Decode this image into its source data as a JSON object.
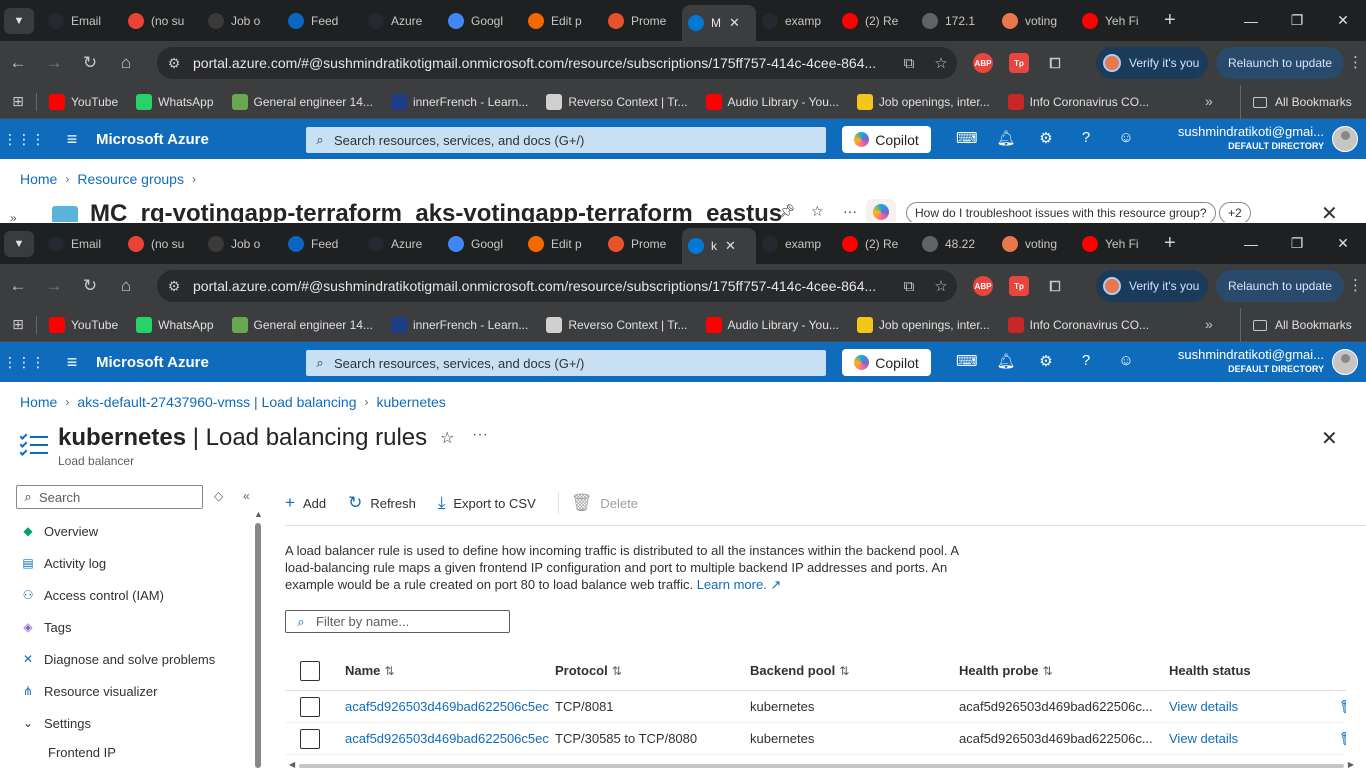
{
  "browser": {
    "back_tabs": [
      {
        "title": "Email",
        "icon": "github-icon",
        "color": "#24292f"
      },
      {
        "title": "(no su",
        "icon": "gmail-icon",
        "color": "#ea4335"
      },
      {
        "title": "Job o",
        "icon": "openai-icon",
        "color": "#3a3a3a"
      },
      {
        "title": "Feed",
        "icon": "linkedin-icon",
        "color": "#0a66c2"
      },
      {
        "title": "Azure",
        "icon": "github-icon",
        "color": "#24292f"
      },
      {
        "title": "Googl",
        "icon": "gemini-icon",
        "color": "#4285f4"
      },
      {
        "title": "Edit p",
        "icon": "grafana-icon",
        "color": "#f46800"
      },
      {
        "title": "Prome",
        "icon": "prometheus-icon",
        "color": "#e6522c"
      },
      {
        "title": "M",
        "icon": "azure-icon",
        "color": "#0078d4",
        "active": true
      },
      {
        "title": "examp",
        "icon": "github-icon",
        "color": "#24292f"
      },
      {
        "title": "(2) Re",
        "icon": "youtube-icon",
        "color": "#ff0000"
      },
      {
        "title": "172.1",
        "icon": "globe-icon",
        "color": "#5f6368"
      },
      {
        "title": "voting",
        "icon": "voting-icon",
        "color": "#e8774b"
      },
      {
        "title": "Yeh Fi",
        "icon": "youtube-icon",
        "color": "#ff0000"
      }
    ],
    "front_tabs": [
      {
        "title": "Email",
        "icon": "github-icon",
        "color": "#24292f"
      },
      {
        "title": "(no su",
        "icon": "gmail-icon",
        "color": "#ea4335"
      },
      {
        "title": "Job o",
        "icon": "openai-icon",
        "color": "#3a3a3a"
      },
      {
        "title": "Feed",
        "icon": "linkedin-icon",
        "color": "#0a66c2"
      },
      {
        "title": "Azure",
        "icon": "github-icon",
        "color": "#24292f"
      },
      {
        "title": "Googl",
        "icon": "gemini-icon",
        "color": "#4285f4"
      },
      {
        "title": "Edit p",
        "icon": "grafana-icon",
        "color": "#f46800"
      },
      {
        "title": "Prome",
        "icon": "prometheus-icon",
        "color": "#e6522c"
      },
      {
        "title": "k",
        "icon": "azure-icon",
        "color": "#0078d4",
        "active": true
      },
      {
        "title": "examp",
        "icon": "github-icon",
        "color": "#24292f"
      },
      {
        "title": "(2) Re",
        "icon": "youtube-icon",
        "color": "#ff0000"
      },
      {
        "title": "48.22",
        "icon": "globe-icon",
        "color": "#5f6368"
      },
      {
        "title": "voting",
        "icon": "voting-icon",
        "color": "#e8774b"
      },
      {
        "title": "Yeh Fi",
        "icon": "youtube-icon",
        "color": "#ff0000"
      }
    ],
    "url": "portal.azure.com/#@sushmindratikotigmail.onmicrosoft.com/resource/subscriptions/175ff757-414c-4cee-864...",
    "verify_label": "Verify it's you",
    "relaunch_label": "Relaunch to update",
    "bookmarks": [
      {
        "label": "YouTube",
        "color": "#ff0000"
      },
      {
        "label": "WhatsApp",
        "color": "#25d366"
      },
      {
        "label": "General engineer 14...",
        "color": "#6aa84f"
      },
      {
        "label": "innerFrench - Learn...",
        "color": "#1f3c88"
      },
      {
        "label": "Reverso Context | Tr...",
        "color": "#d0d0d0"
      },
      {
        "label": "Audio Library - You...",
        "color": "#ff0000"
      },
      {
        "label": "Job openings, inter...",
        "color": "#f5c518"
      },
      {
        "label": "Info Coronavirus CO...",
        "color": "#c62828"
      }
    ],
    "all_bookmarks": "All Bookmarks"
  },
  "azure": {
    "brand": "Microsoft Azure",
    "search_placeholder": "Search resources, services, and docs (G+/)",
    "copilot": "Copilot",
    "account_email": "sushmindratikoti@gmai...",
    "account_dir": "DEFAULT DIRECTORY",
    "accent": "#0f6cbd"
  },
  "back_page": {
    "crumbs": [
      "Home",
      "Resource groups"
    ],
    "title": "MC_rg-votingapp-terraform_aks-votingapp-terraform_eastus",
    "chip_question": "How do I troubleshoot issues with this resource group?",
    "chip_more": "+2"
  },
  "page": {
    "crumbs": [
      "Home",
      "aks-default-27437960-vmss | Load balancing",
      "kubernetes"
    ],
    "title_main": "kubernetes",
    "title_rest": " | Load balancing rules",
    "subtitle": "Load balancer",
    "side_search_placeholder": "Search",
    "menu": [
      {
        "label": "Overview",
        "icon": "overview-icon",
        "color": "#00a36c",
        "glyph": "◆"
      },
      {
        "label": "Activity log",
        "icon": "activity-log-icon",
        "color": "#0f6cbd",
        "glyph": "▤"
      },
      {
        "label": "Access control (IAM)",
        "icon": "iam-icon",
        "color": "#0f6cbd",
        "glyph": "⚇"
      },
      {
        "label": "Tags",
        "icon": "tag-icon",
        "color": "#8661c5",
        "glyph": "◈"
      },
      {
        "label": "Diagnose and solve problems",
        "icon": "diagnose-icon",
        "color": "#0f6cbd",
        "glyph": "✕"
      },
      {
        "label": "Resource visualizer",
        "icon": "visualizer-icon",
        "color": "#0f6cbd",
        "glyph": "⋔"
      },
      {
        "label": "Settings",
        "icon": "chevron-down-icon",
        "color": "#323130",
        "glyph": "⌄"
      }
    ],
    "submenu": {
      "label": "Frontend IP",
      "icon": "frontend-ip-icon"
    },
    "toolbar": {
      "add": "Add",
      "refresh": "Refresh",
      "export": "Export to CSV",
      "delete": "Delete"
    },
    "description": "A load balancer rule is used to define how incoming traffic is distributed to all the instances within the backend pool. A load-balancing rule maps a given frontend IP configuration and port to multiple backend IP addresses and ports. An example would be a rule created on port 80 to load balance web traffic.",
    "learn_more": "Learn more.",
    "filter_placeholder": "Filter by name...",
    "columns": [
      "Name",
      "Protocol",
      "Backend pool",
      "Health probe",
      "Health status"
    ],
    "rows": [
      {
        "name": "acaf5d926503d469bad622506c5ec",
        "protocol": "TCP/8081",
        "pool": "kubernetes",
        "probe": "acaf5d926503d469bad622506c...",
        "status": "View details"
      },
      {
        "name": "acaf5d926503d469bad622506c5ec",
        "protocol": "TCP/30585 to TCP/8080",
        "pool": "kubernetes",
        "probe": "acaf5d926503d469bad622506c...",
        "status": "View details"
      }
    ]
  }
}
